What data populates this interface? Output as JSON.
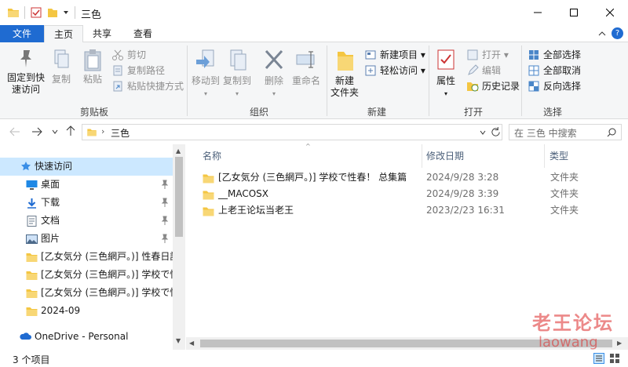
{
  "window": {
    "title": "三色"
  },
  "ribbon_tabs": {
    "file": "文件",
    "home": "主页",
    "share": "共享",
    "view": "查看"
  },
  "ribbon": {
    "clipboard": {
      "pin": "固定到快\n速访问",
      "copy": "复制",
      "paste": "粘贴",
      "cut": "剪切",
      "copy_path": "复制路径",
      "paste_shortcut": "粘贴快捷方式",
      "label": "剪贴板"
    },
    "organize": {
      "move_to": "移动到",
      "copy_to": "复制到",
      "delete": "删除",
      "rename": "重命名",
      "label": "组织"
    },
    "new": {
      "new_folder": "新建\n文件夹",
      "new_item": "新建项目",
      "easy_access": "轻松访问",
      "label": "新建"
    },
    "open": {
      "properties": "属性",
      "open": "打开",
      "edit": "编辑",
      "history": "历史记录",
      "label": "打开"
    },
    "select": {
      "select_all": "全部选择",
      "select_none": "全部取消",
      "invert": "反向选择",
      "label": "选择"
    }
  },
  "address": {
    "path": "三色",
    "search_placeholder": "在 三色 中搜索"
  },
  "nav": {
    "quick_access": "快速访问",
    "items": [
      {
        "label": "桌面",
        "icon": "desktop-icon",
        "pinned": true
      },
      {
        "label": "下载",
        "icon": "download-icon",
        "pinned": true
      },
      {
        "label": "文档",
        "icon": "document-icon",
        "pinned": true
      },
      {
        "label": "图片",
        "icon": "picture-icon",
        "pinned": true
      },
      {
        "label": "[乙女気分 (三色網戸。)] 性春日記",
        "icon": "folder-icon",
        "pinned": false
      },
      {
        "label": "[乙女気分 (三色網戸。)] 学校で性",
        "icon": "folder-icon",
        "pinned": false
      },
      {
        "label": "[乙女気分 (三色網戸。)] 学校で性",
        "icon": "folder-icon",
        "pinned": false
      },
      {
        "label": "2024-09",
        "icon": "folder-icon",
        "pinned": false
      }
    ],
    "onedrive": "OneDrive - Personal"
  },
  "columns": {
    "name": "名称",
    "modified": "修改日期",
    "type": "类型"
  },
  "files": [
    {
      "name": "[乙女気分 (三色網戸。)] 学校で性春！ 总集篇",
      "modified": "2024/9/28 3:28",
      "type": "文件夹"
    },
    {
      "name": "__MACOSX",
      "modified": "2024/9/28 3:39",
      "type": "文件夹"
    },
    {
      "name": "上老王论坛当老王",
      "modified": "2023/2/23 16:31",
      "type": "文件夹"
    }
  ],
  "status": {
    "count": "3 个项目"
  },
  "watermark": {
    "line1": "老王论坛",
    "line2": "laowang"
  },
  "colors": {
    "accent": "#1f6bd1",
    "folder": "#f4c642",
    "select": "#cce8ff"
  }
}
